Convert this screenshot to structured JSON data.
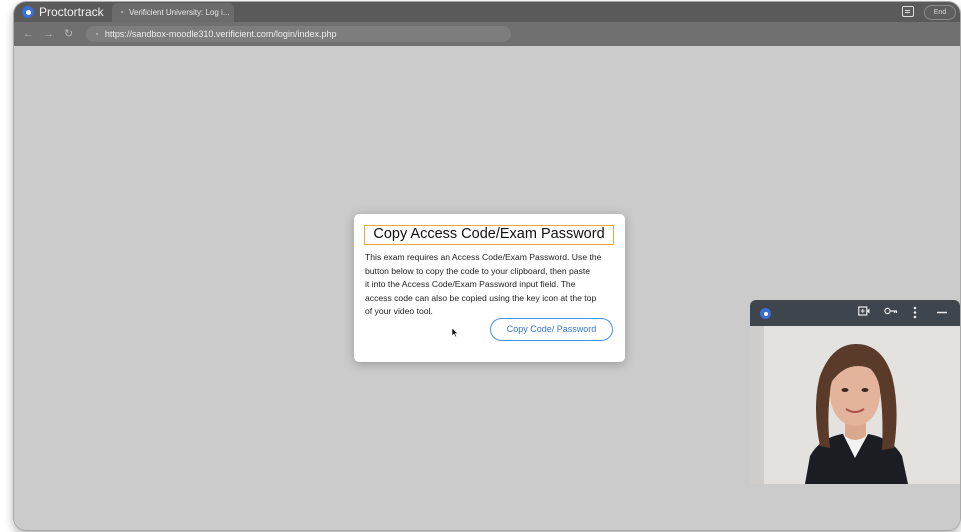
{
  "app": {
    "title": "Proctortrack"
  },
  "tab": {
    "label": "Verificient University: Log i..."
  },
  "header": {
    "end_label": "End"
  },
  "address": {
    "url": "https://sandbox-moodle310.verificient.com/login/index.php"
  },
  "modal": {
    "title": "Copy Access Code/Exam Password",
    "body_lines": [
      "This exam requires an Access Code/Exam Password. Use the",
      "button below to copy the code to your clipboard, then paste",
      "it into the Access Code/Exam Password input field. The",
      "access code can also be copied using the key icon at the top",
      "of your video tool."
    ],
    "button_label": "Copy Code/ Password"
  },
  "icons": {
    "app_logo": "proctortrack-logo-icon",
    "feedback": "feedback-icon",
    "back": "back-arrow-icon",
    "forward": "forward-arrow-icon",
    "reload": "reload-icon",
    "site": "site-info-icon",
    "screen": "screen-share-icon",
    "key": "key-icon",
    "more": "more-vertical-icon",
    "minimize": "minimize-icon"
  },
  "colors": {
    "title_border": "#e9a93b",
    "button_accent": "#4a90e2",
    "brand_blue": "#3b6fd8"
  }
}
